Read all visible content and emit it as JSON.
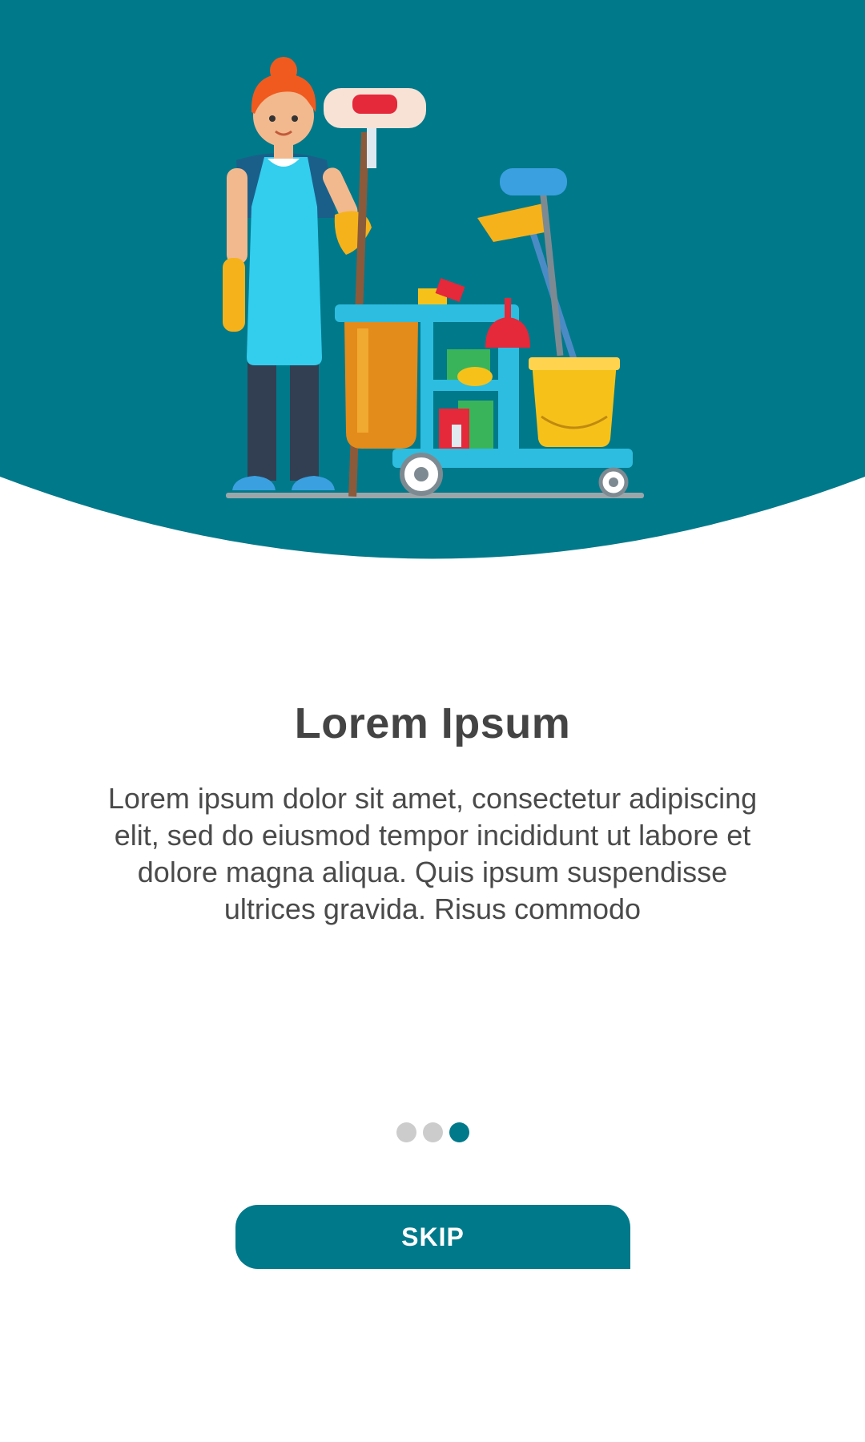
{
  "colors": {
    "primary": "#00798A",
    "dot_inactive": "#cccccc",
    "heading": "#444444",
    "text": "#4a4a4a"
  },
  "hero": {
    "illustration": "janitor-with-cleaning-cart"
  },
  "title": "Lorem Ipsum",
  "description": "Lorem ipsum dolor sit amet, consectetur adipiscing elit, sed do eiusmod tempor incididunt ut labore et dolore magna aliqua. Quis ipsum suspendisse ultrices gravida. Risus commodo",
  "pager": {
    "total": 3,
    "active": 3
  },
  "skip_button": {
    "label": "SKIP"
  }
}
